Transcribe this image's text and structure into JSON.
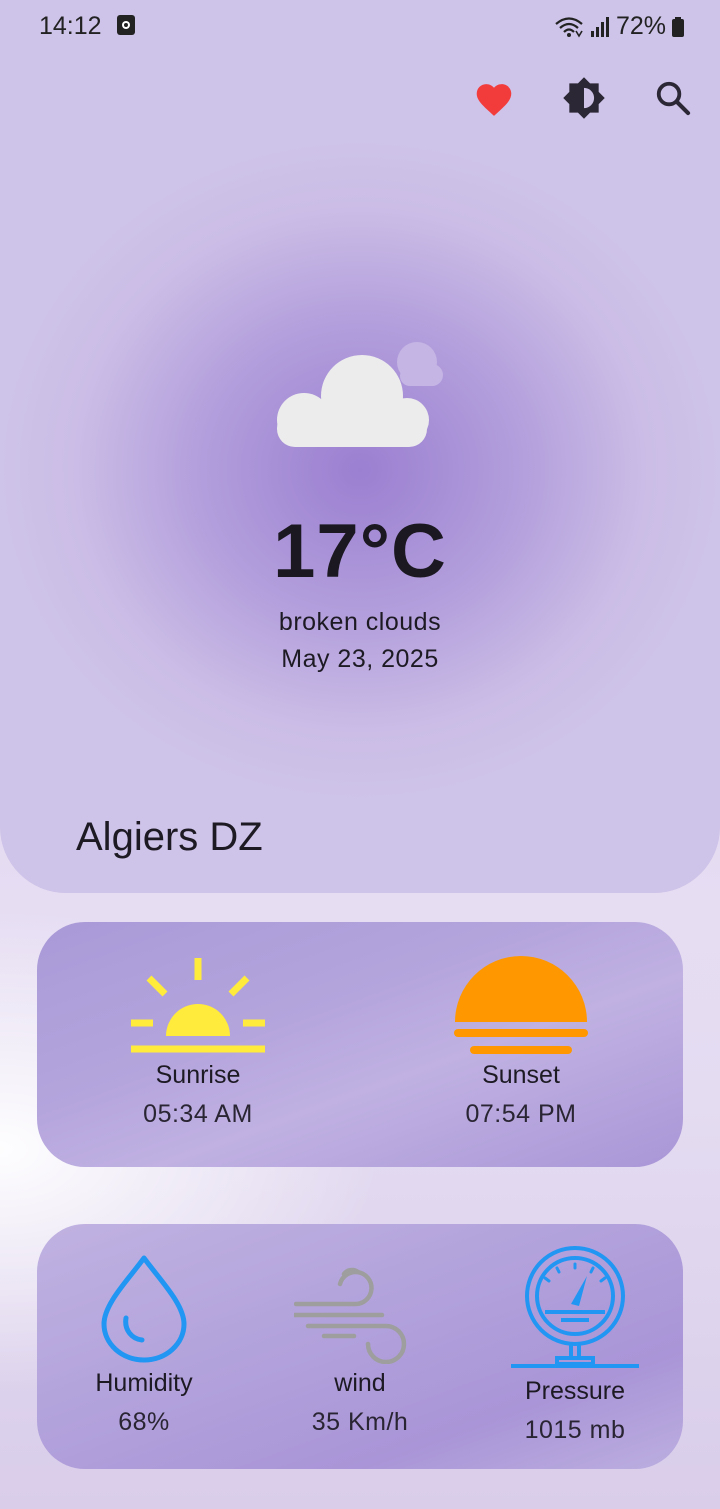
{
  "status_bar": {
    "time": "14:12",
    "battery": "72%",
    "icons": [
      "app-notification-icon",
      "wifi-icon",
      "signal-icon",
      "battery-icon"
    ]
  },
  "toolbar": {
    "icons": [
      "heart-icon",
      "brightness-icon",
      "search-icon"
    ],
    "heart_color": "#f23c3c"
  },
  "weather": {
    "icon": "broken-clouds-icon",
    "temperature": "17°C",
    "description": "broken clouds",
    "date": "May 23, 2025",
    "city": "Algiers DZ"
  },
  "sun": {
    "sunrise_label": "Sunrise",
    "sunrise_time": "05:34 AM",
    "sunset_label": "Sunset",
    "sunset_time": "07:54 PM",
    "sunrise_color": "#ffeb3b",
    "sunset_color": "#ff9800"
  },
  "stats": {
    "humidity_label": "Humidity",
    "humidity_value": "68%",
    "wind_label": "wind",
    "wind_value": "35 Km/h",
    "pressure_label": "Pressure",
    "pressure_value": "1015 mb",
    "humidity_color": "#2196f3",
    "wind_color": "#9e9e9e",
    "pressure_color": "#2196f3"
  }
}
